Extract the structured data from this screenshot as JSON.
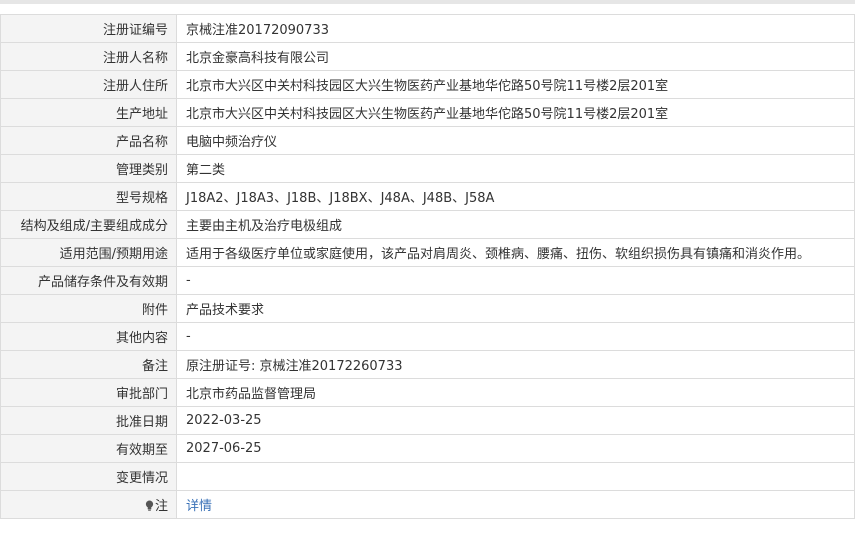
{
  "rows": [
    {
      "label": "注册证编号",
      "value": "京械注准20172090733"
    },
    {
      "label": "注册人名称",
      "value": "北京金豪高科技有限公司"
    },
    {
      "label": "注册人住所",
      "value": "北京市大兴区中关村科技园区大兴生物医药产业基地华佗路50号院11号楼2层201室"
    },
    {
      "label": "生产地址",
      "value": "北京市大兴区中关村科技园区大兴生物医药产业基地华佗路50号院11号楼2层201室"
    },
    {
      "label": "产品名称",
      "value": "电脑中频治疗仪"
    },
    {
      "label": "管理类别",
      "value": "第二类"
    },
    {
      "label": "型号规格",
      "value": "J18A2、J18A3、J18B、J18BX、J48A、J48B、J58A"
    },
    {
      "label": "结构及组成/主要组成成分",
      "value": "主要由主机及治疗电极组成"
    },
    {
      "label": "适用范围/预期用途",
      "value": "适用于各级医疗单位或家庭使用，该产品对肩周炎、颈椎病、腰痛、扭伤、软组织损伤具有镇痛和消炎作用。"
    },
    {
      "label": "产品储存条件及有效期",
      "value": "-"
    },
    {
      "label": "附件",
      "value": "产品技术要求"
    },
    {
      "label": "其他内容",
      "value": "-"
    },
    {
      "label": "备注",
      "value": "原注册证号: 京械注准20172260733"
    },
    {
      "label": "审批部门",
      "value": "北京市药品监督管理局"
    },
    {
      "label": "批准日期",
      "value": "2022-03-25"
    },
    {
      "label": "有效期至",
      "value": "2027-06-25"
    },
    {
      "label": "变更情况",
      "value": ""
    }
  ],
  "note": {
    "icon": "lightbulb-icon",
    "label": "注",
    "link_text": "详情",
    "link_color": "#3a72b8"
  }
}
